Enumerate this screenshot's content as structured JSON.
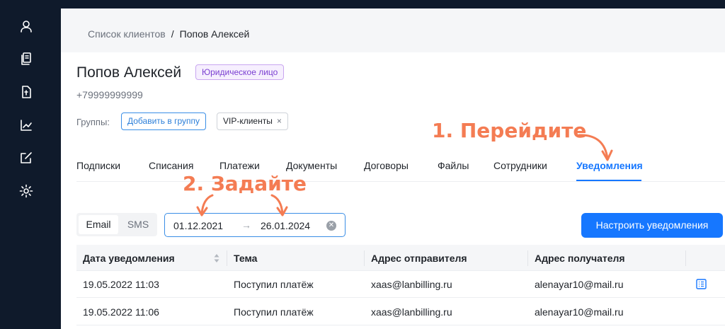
{
  "sidebar": {
    "items": [
      {
        "icon": "user-icon"
      },
      {
        "icon": "documents-icon"
      },
      {
        "icon": "invoice-icon"
      },
      {
        "icon": "chart-icon"
      },
      {
        "icon": "edit-icon"
      },
      {
        "icon": "gear-icon"
      }
    ]
  },
  "breadcrumb": {
    "parent": "Список клиентов",
    "separator": "/",
    "current": "Попов Алексей"
  },
  "client": {
    "name": "Попов Алексей",
    "type_badge": "Юридическое лицо",
    "phone": "+79999999999"
  },
  "groups": {
    "label": "Группы:",
    "add_button": "Добавить в группу",
    "tags": [
      {
        "label": "VIP-клиенты",
        "remove": "×"
      }
    ]
  },
  "tabs": [
    {
      "label": "Подписки",
      "active": false
    },
    {
      "label": "Списания",
      "active": false
    },
    {
      "label": "Платежи",
      "active": false
    },
    {
      "label": "Документы",
      "active": false
    },
    {
      "label": "Договоры",
      "active": false
    },
    {
      "label": "Файлы",
      "active": false
    },
    {
      "label": "Сотрудники",
      "active": false
    },
    {
      "label": "Уведомления",
      "active": true
    }
  ],
  "filters": {
    "channels": [
      {
        "label": "Email",
        "selected": true
      },
      {
        "label": "SMS",
        "selected": false
      }
    ],
    "date_start": "01.12.2021",
    "date_arrow": "→",
    "date_end": "26.01.2024",
    "setup_button": "Настроить уведомления"
  },
  "table": {
    "columns": [
      "Дата уведомления",
      "Тема",
      "Адрес отправителя",
      "Адрес получателя"
    ],
    "rows": [
      {
        "date": "19.05.2022 11:03",
        "subject": "Поступил платёж",
        "sender": "xaas@lanbilling.ru",
        "recipient": "alenayar10@mail.ru"
      },
      {
        "date": "19.05.2022 11:06",
        "subject": "Поступил платёж",
        "sender": "xaas@lanbilling.ru",
        "recipient": "alenayar10@mail.ru"
      }
    ]
  },
  "annotations": {
    "step1": "1. Перейдите",
    "step2": "2. Задайте",
    "color": "#f47c53"
  },
  "colors": {
    "accent": "#1677ff",
    "sidebar": "#0f1a2b",
    "badge_purple": "#7a3fd1"
  }
}
